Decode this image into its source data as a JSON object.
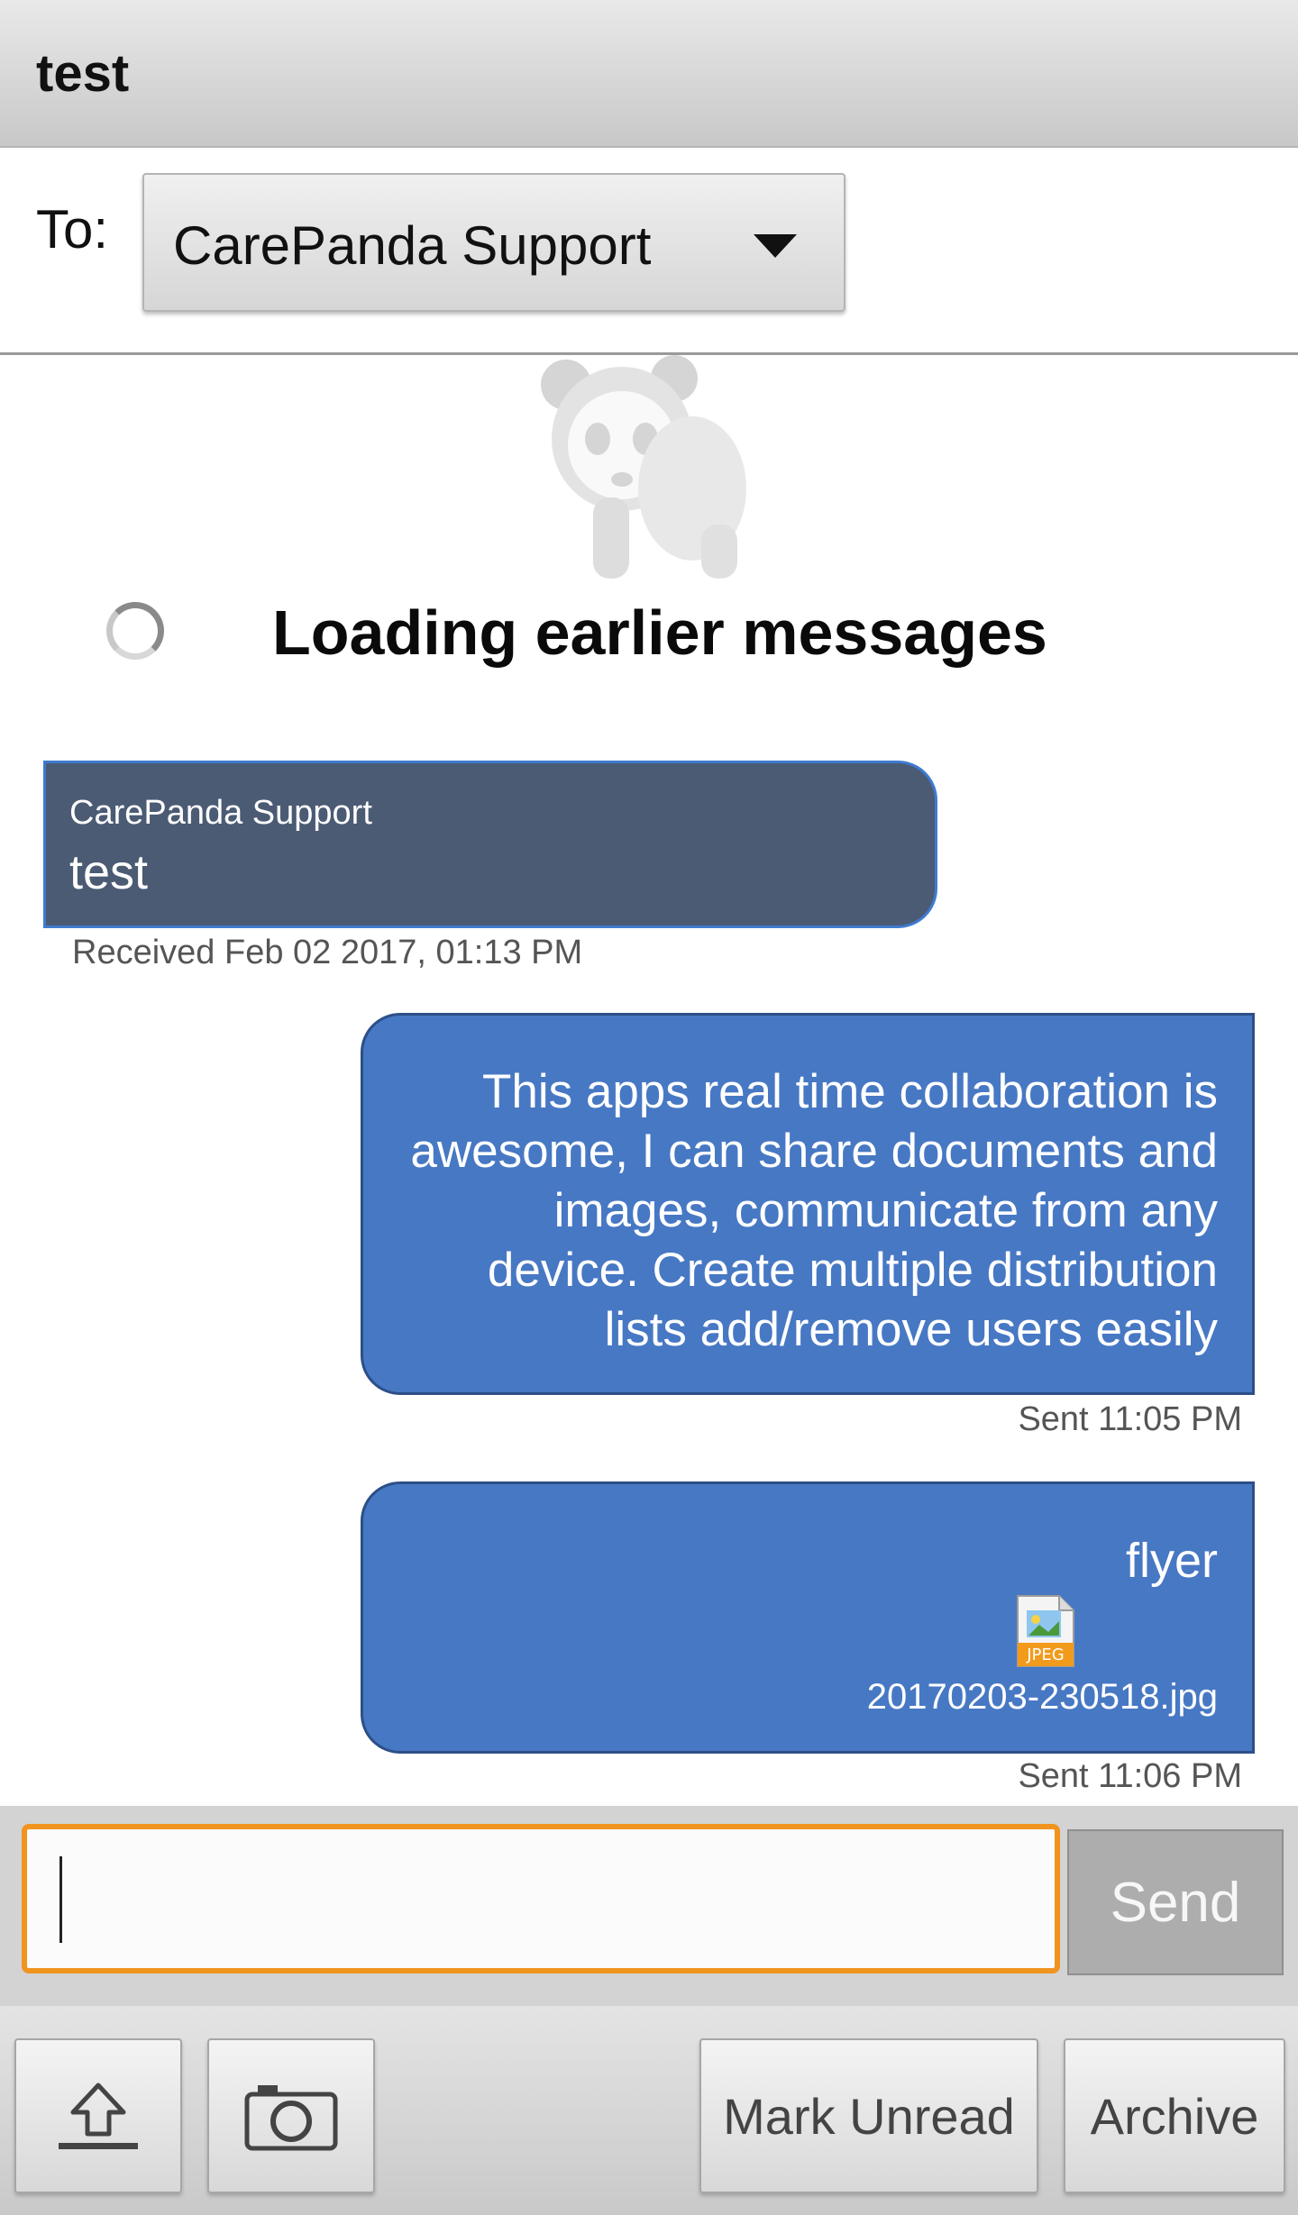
{
  "header": {
    "title": "test"
  },
  "recipient": {
    "label": "To:",
    "selected": "CarePanda Support"
  },
  "loading": {
    "text": "Loading earlier messages"
  },
  "messages": [
    {
      "direction": "received",
      "sender": "CarePanda Support",
      "text": "test",
      "meta": "Received Feb 02 2017, 01:13 PM"
    },
    {
      "direction": "sent",
      "text": "This apps real time collaboration is awesome, I can share documents and images, communicate from any device. Create multiple distribution lists add/remove users easily",
      "meta": "Sent 11:05 PM"
    },
    {
      "direction": "sent",
      "text": "flyer",
      "attachment": {
        "type": "JPEG",
        "filename": "20170203-230518.jpg"
      },
      "meta": "Sent 11:06 PM"
    }
  ],
  "compose": {
    "value": "",
    "send_label": "Send"
  },
  "toolbar": {
    "upload_icon": "upload-icon",
    "camera_icon": "camera-icon",
    "mark_unread_label": "Mark Unread",
    "archive_label": "Archive"
  },
  "colors": {
    "received_bubble": "#4b5b74",
    "sent_bubble": "#4778c4",
    "input_focus": "#f0941f"
  }
}
